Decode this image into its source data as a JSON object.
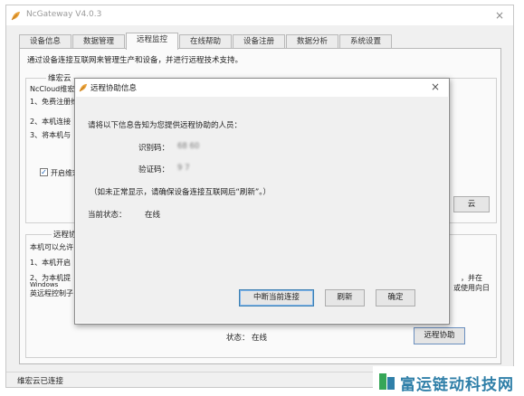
{
  "app": {
    "title": "NcGateway V4.0.3",
    "close_glyph": "×",
    "icon": "leaf-icon"
  },
  "tabs": [
    {
      "label": "设备信息",
      "active": false
    },
    {
      "label": "数据管理",
      "active": false
    },
    {
      "label": "远程监控",
      "active": true
    },
    {
      "label": "在线帮助",
      "active": false
    },
    {
      "label": "设备注册",
      "active": false
    },
    {
      "label": "数据分析",
      "active": false
    },
    {
      "label": "系统设置",
      "active": false
    }
  ],
  "panel": {
    "description": "通过设备连接互联网来管理生产和设备，并进行远程技术支持。"
  },
  "cloud_group": {
    "title": "维宏云",
    "lines": [
      "NcCloud维宏云",
      "1、免费注册维",
      "2、本机连接",
      "3、将本机与"
    ],
    "checkbox_label": "开启维宏",
    "checkbox_checked": true,
    "button_partial": "云"
  },
  "remote_group": {
    "title": "远程协",
    "lines": [
      "本机可以允许",
      "1、本机开启",
      "2、为本机提",
      "Windows",
      "英远程控制子"
    ],
    "right_fragments": [
      "，并在",
      "或使用向日"
    ],
    "status_label": "状态：",
    "status_value": "在线",
    "remote_button": "远程协助"
  },
  "statusbar": {
    "text": "维宏云已连接"
  },
  "dialog": {
    "title": "远程协助信息",
    "close_glyph": "×",
    "intro": "请将以下信息告知为您提供远程协助的人员：",
    "id_label": "识别码：",
    "id_value": "68      60",
    "code_label": "验证码：",
    "code_value": "9    7",
    "note": "（如未正常显示，请确保设备连接互联网后“刷新”。）",
    "status_label": "当前状态：",
    "status_value": "在线",
    "buttons": {
      "disconnect": "中断当前连接",
      "refresh": "刷新",
      "ok": "确定"
    }
  },
  "watermark": {
    "text": "富运链动科技网",
    "color": "#2f7fa8"
  }
}
